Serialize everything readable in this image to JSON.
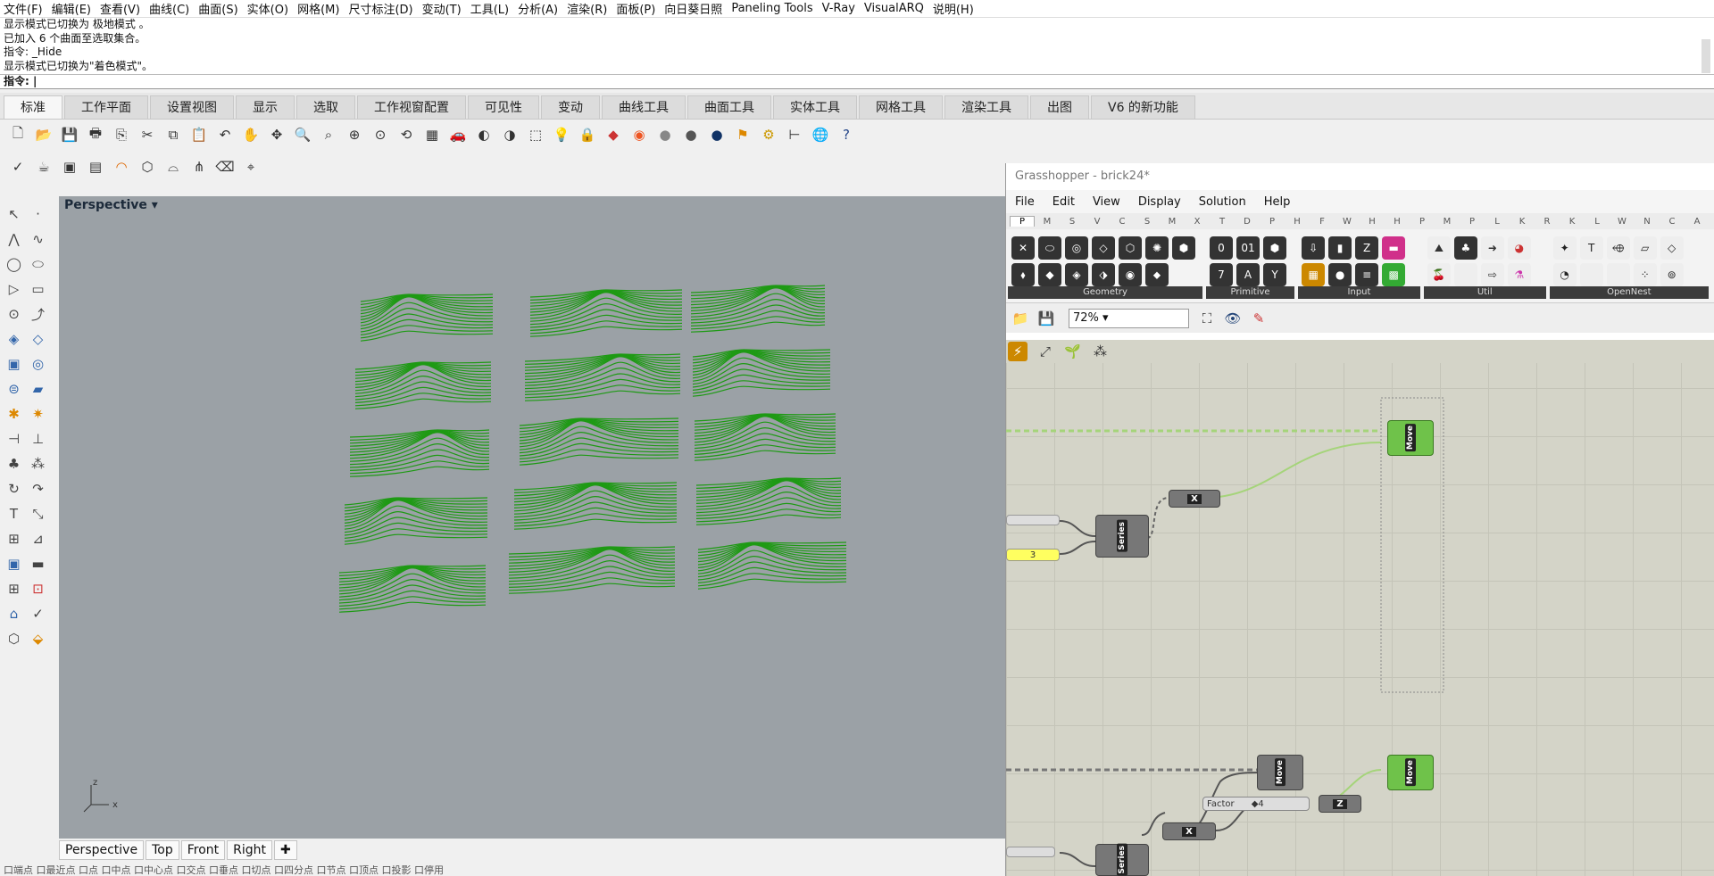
{
  "menubar": [
    "文件(F)",
    "编辑(E)",
    "查看(V)",
    "曲线(C)",
    "曲面(S)",
    "实体(O)",
    "网格(M)",
    "尺寸标注(D)",
    "变动(T)",
    "工具(L)",
    "分析(A)",
    "渲染(R)",
    "面板(P)",
    "向日葵日照",
    "Paneling Tools",
    "V-Ray",
    "VisualARQ",
    "说明(H)"
  ],
  "command_history": [
    "显示模式已切换为 极地模式 。",
    "已加入 6 个曲面至选取集合。",
    "指令: _Hide",
    "显示模式已切换为\"着色模式\"。"
  ],
  "command_prompt": "指令:",
  "tabs": [
    "标准",
    "工作平面",
    "设置视图",
    "显示",
    "选取",
    "工作视窗配置",
    "可见性",
    "变动",
    "曲线工具",
    "曲面工具",
    "实体工具",
    "网格工具",
    "渲染工具",
    "出图",
    "V6 的新功能"
  ],
  "active_tab": "标准",
  "viewport": {
    "title": "Perspective",
    "axis_x": "x",
    "axis_z": "z",
    "bottom_tabs": [
      "Perspective",
      "Top",
      "Front",
      "Right"
    ]
  },
  "status_text": "口端点 口最近点 口点 口中点 口中心点 口交点 口垂点 口切点 口四分点 口节点 口顶点 口投影 口停用",
  "grasshopper": {
    "title": "Grasshopper - brick24*",
    "menu": [
      "File",
      "Edit",
      "View",
      "Display",
      "Solution",
      "Help"
    ],
    "categories": [
      "P",
      "M",
      "S",
      "V",
      "C",
      "S",
      "M",
      "X",
      "T",
      "D",
      "P",
      "H",
      "F",
      "W",
      "H",
      "H",
      "P",
      "M",
      "P",
      "L",
      "K",
      "R",
      "K",
      "L",
      "W",
      "N",
      "C",
      "A"
    ],
    "groups": [
      "Geometry",
      "Primitive",
      "Input",
      "Util",
      "OpenNest"
    ],
    "zoom": "72%",
    "components": {
      "move": "Move",
      "series": "Series",
      "factor": "Factor",
      "factor_value": "◆4",
      "x_vec": "X",
      "z_vec": "Z",
      "num": "3"
    }
  },
  "colors": {
    "geometry": "#1e9a14",
    "viewport_bg": "#9ba1a6",
    "canvas_bg": "#d4d4c8",
    "component_green": "#6fc24a"
  }
}
